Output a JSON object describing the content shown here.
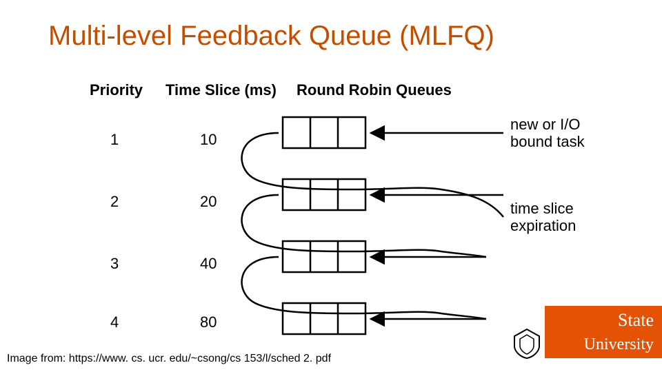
{
  "title": "Multi-level Feedback Queue (MLFQ)",
  "headers": {
    "priority": "Priority",
    "timeslice": "Time Slice (ms)",
    "queues": "Round Robin Queues"
  },
  "rows": [
    {
      "priority": "1",
      "timeslice": "10"
    },
    {
      "priority": "2",
      "timeslice": "20"
    },
    {
      "priority": "3",
      "timeslice": "40"
    },
    {
      "priority": "4",
      "timeslice": "80"
    }
  ],
  "annotations": {
    "new_task_l1": "new or I/O",
    "new_task_l2": "bound task",
    "expire_l1": "time slice",
    "expire_l2": "expiration"
  },
  "attribution": "Image from: https://www. cs. ucr. edu/~csong/cs 153/l/sched 2. pdf",
  "logo": {
    "line1": "State",
    "line2": "University"
  },
  "chart_data": {
    "type": "table",
    "title": "MLFQ priority levels and time slices",
    "columns": [
      "Priority",
      "Time Slice (ms)"
    ],
    "rows": [
      [
        1,
        10
      ],
      [
        2,
        20
      ],
      [
        3,
        40
      ],
      [
        4,
        80
      ]
    ],
    "notes": [
      "new or I/O bound task enters at priority 1",
      "on time slice expiration a task moves to the next lower-priority queue"
    ]
  }
}
